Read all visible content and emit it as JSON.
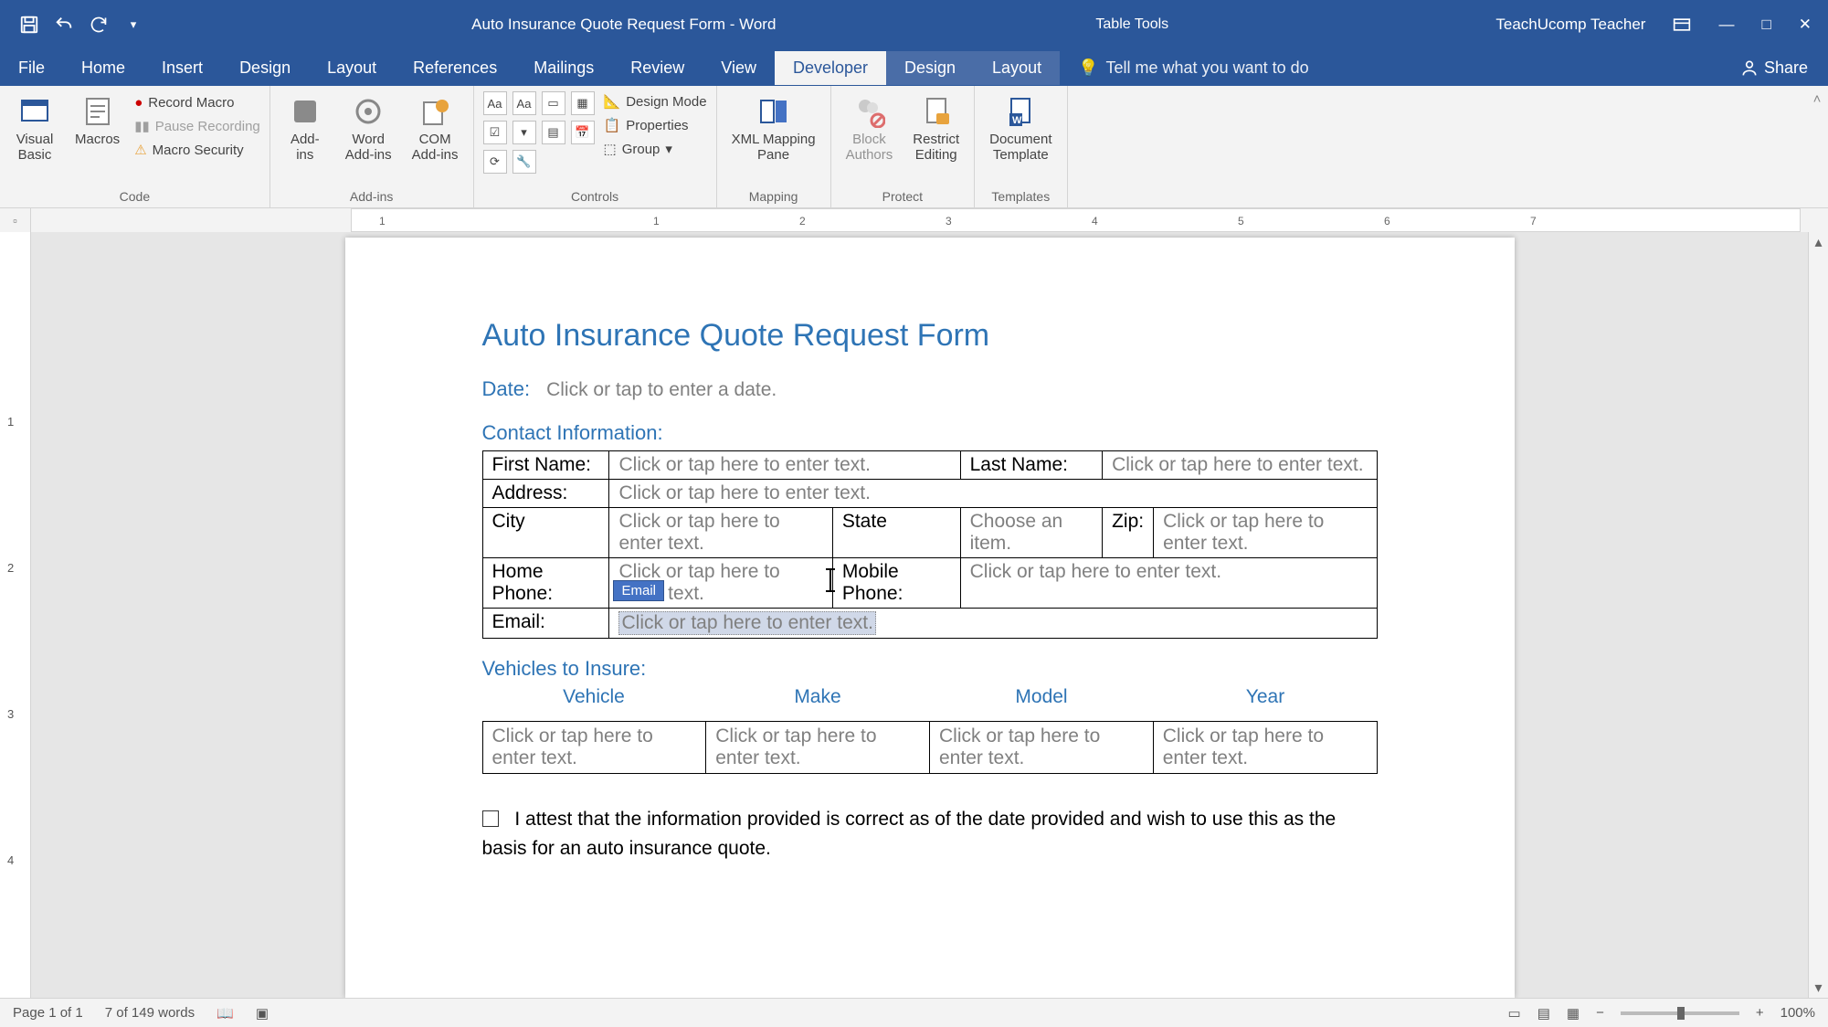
{
  "titlebar": {
    "doc_title": "Auto Insurance Quote Request Form - Word",
    "context_tab": "Table Tools",
    "user": "TeachUcomp Teacher"
  },
  "tabs": {
    "file": "File",
    "home": "Home",
    "insert": "Insert",
    "design": "Design",
    "layout": "Layout",
    "references": "References",
    "mailings": "Mailings",
    "review": "Review",
    "view": "View",
    "developer": "Developer",
    "ctx_design": "Design",
    "ctx_layout": "Layout",
    "tell_me": "Tell me what you want to do",
    "share": "Share"
  },
  "ribbon": {
    "code": {
      "visual_basic": "Visual\nBasic",
      "macros": "Macros",
      "record": "Record Macro",
      "pause": "Pause Recording",
      "security": "Macro Security",
      "group": "Code"
    },
    "addins": {
      "addins": "Add-\nins",
      "word_addins": "Word\nAdd-ins",
      "com_addins": "COM\nAdd-ins",
      "group": "Add-ins"
    },
    "controls": {
      "design_mode": "Design Mode",
      "properties": "Properties",
      "group_btn": "Group",
      "group": "Controls"
    },
    "mapping": {
      "xml_pane": "XML Mapping\nPane",
      "group": "Mapping"
    },
    "protect": {
      "block_authors": "Block\nAuthors",
      "restrict_editing": "Restrict\nEditing",
      "group": "Protect"
    },
    "templates": {
      "doc_template": "Document\nTemplate",
      "group": "Templates"
    }
  },
  "document": {
    "title": "Auto Insurance Quote Request Form",
    "date_label": "Date:",
    "date_ph": "Click or tap to enter a date.",
    "contact_header": "Contact Information:",
    "contact": {
      "first_name_lbl": "First Name:",
      "first_name_ph": "Click or tap here to enter text.",
      "last_name_lbl": "Last Name:",
      "last_name_ph": "Click or tap here to enter text.",
      "address_lbl": "Address:",
      "address_ph": "Click or tap here to enter text.",
      "city_lbl": "City",
      "city_ph": "Click or tap here to enter text.",
      "state_lbl": "State",
      "state_ph": "Choose an item.",
      "zip_lbl": "Zip:",
      "zip_ph": "Click or tap here to enter text.",
      "home_lbl": "Home Phone:",
      "home_ph": "Click or tap here to enter text.",
      "mobile_lbl": "Mobile Phone:",
      "mobile_ph": "Click or tap here to enter text.",
      "email_lbl": "Email:",
      "email_ph": "Click or tap here to enter text.",
      "email_tag": "Email"
    },
    "vehicles_header": "Vehicles to Insure:",
    "vehicles": {
      "col_vehicle": "Vehicle",
      "col_make": "Make",
      "col_model": "Model",
      "col_year": "Year",
      "cell_ph": "Click or tap here to enter text."
    },
    "attest": "I attest that the information provided is correct as of the date provided and wish to use this as the basis for an auto insurance quote."
  },
  "statusbar": {
    "page": "Page 1 of 1",
    "words": "7 of 149 words",
    "zoom": "100%"
  }
}
